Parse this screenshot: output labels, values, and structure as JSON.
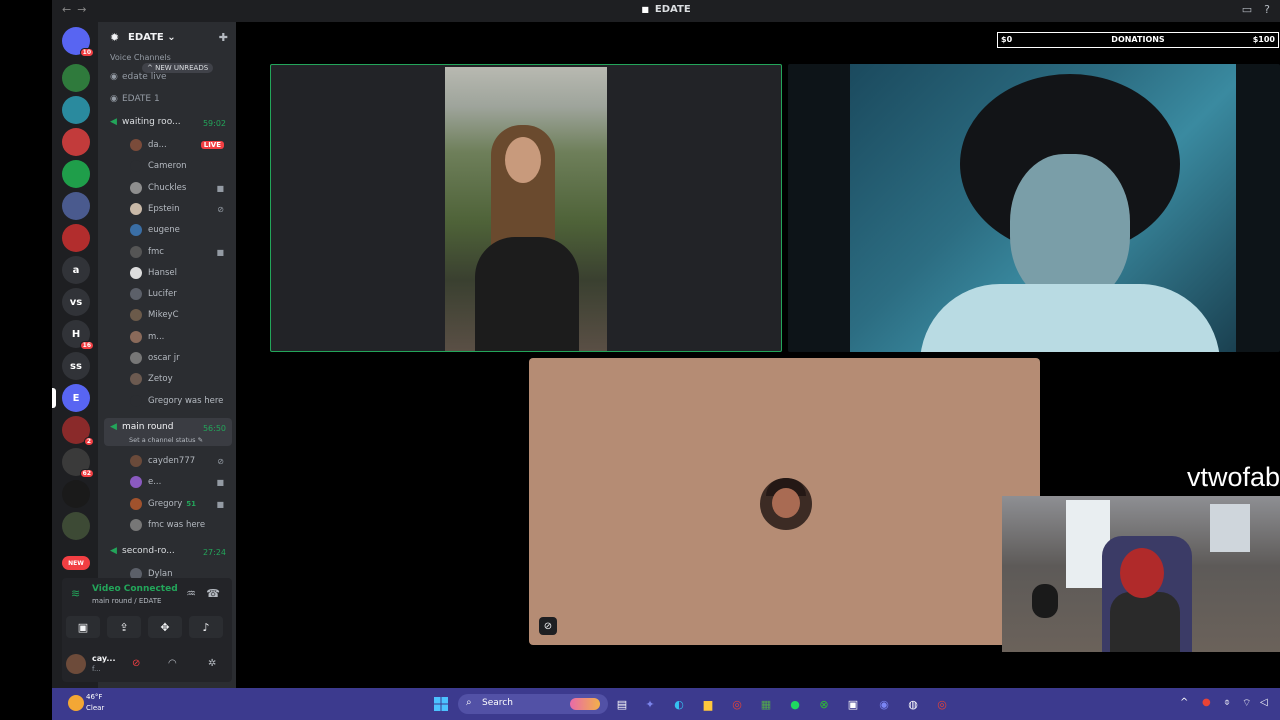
{
  "window": {
    "title": "EDATE",
    "logo_icon": "discord-logo-icon"
  },
  "server_rail": {
    "servers": [
      {
        "label": "",
        "badge": "10",
        "color": "#5865f2",
        "icon": "discord-home-icon"
      },
      {
        "label": "",
        "badge": "",
        "color": "#2f7a3c"
      },
      {
        "label": "",
        "badge": "",
        "color": "#2a8a9e"
      },
      {
        "label": "",
        "badge": "",
        "color": "#c23b3b"
      },
      {
        "label": "",
        "badge": "",
        "color": "#1f9e4a"
      },
      {
        "label": "",
        "badge": "",
        "color": "#4a5a8e"
      },
      {
        "label": "",
        "badge": "",
        "color": "#b22d2d"
      },
      {
        "label": "a",
        "badge": "",
        "color": "#313338"
      },
      {
        "label": "vs",
        "badge": "",
        "color": "#313338"
      },
      {
        "label": "H",
        "badge": "16",
        "color": "#313338"
      },
      {
        "label": "ss",
        "badge": "",
        "color": "#313338"
      },
      {
        "label": "E",
        "badge": "",
        "color": "#5865f2"
      },
      {
        "label": "",
        "badge": "2",
        "color": "#8a2a2a"
      },
      {
        "label": "",
        "badge": "62",
        "color": "#3a3a3a"
      },
      {
        "label": "",
        "badge": "",
        "color": "#1a1a1a"
      },
      {
        "label": "",
        "badge": "",
        "color": "#3d4a35"
      },
      {
        "label": "NEW",
        "badge": "",
        "color": "#f23f43"
      }
    ]
  },
  "sidebar": {
    "guild_name": "EDATE",
    "voice_channels_header": "Voice Channels",
    "new_unreads": "NEW UNREADS",
    "channels": [
      {
        "name": "edate live",
        "time": ""
      },
      {
        "name": "EDATE 1",
        "time": ""
      },
      {
        "name": "waiting roo...",
        "time": "59:02"
      },
      {
        "name": "main round",
        "time": "56:50",
        "status": "Set a channel status"
      },
      {
        "name": "second-ro...",
        "time": "27:24"
      }
    ],
    "waiting_members": [
      {
        "name": "da...",
        "live": "LIVE"
      },
      {
        "name": "Cameron"
      },
      {
        "name": "Chuckles"
      },
      {
        "name": "Epstein"
      },
      {
        "name": "eugene"
      },
      {
        "name": "fmc"
      },
      {
        "name": "Hansel"
      },
      {
        "name": "Lucifer"
      },
      {
        "name": "MikeyC"
      },
      {
        "name": "m..."
      },
      {
        "name": "oscar jr"
      },
      {
        "name": "Zetoy"
      },
      {
        "name": "Gregory was here"
      }
    ],
    "main_round_members": [
      {
        "name": "cayden777"
      },
      {
        "name": "e..."
      },
      {
        "name": "Gregory",
        "extra": "51"
      },
      {
        "name": "fmc was here"
      }
    ],
    "second_round_members": [
      {
        "name": "Dylan"
      }
    ]
  },
  "voice_panel": {
    "status": "Video Connected",
    "location": "main round / EDATE",
    "user_name": "cay...",
    "user_status": "f..."
  },
  "stage": {
    "donations": {
      "left": "$0",
      "label": "DONATIONS",
      "right": "$100"
    },
    "streamer_name": "vtwofab"
  },
  "taskbar": {
    "weather_temp": "46°F",
    "weather_desc": "Clear",
    "search_label": "Search"
  }
}
